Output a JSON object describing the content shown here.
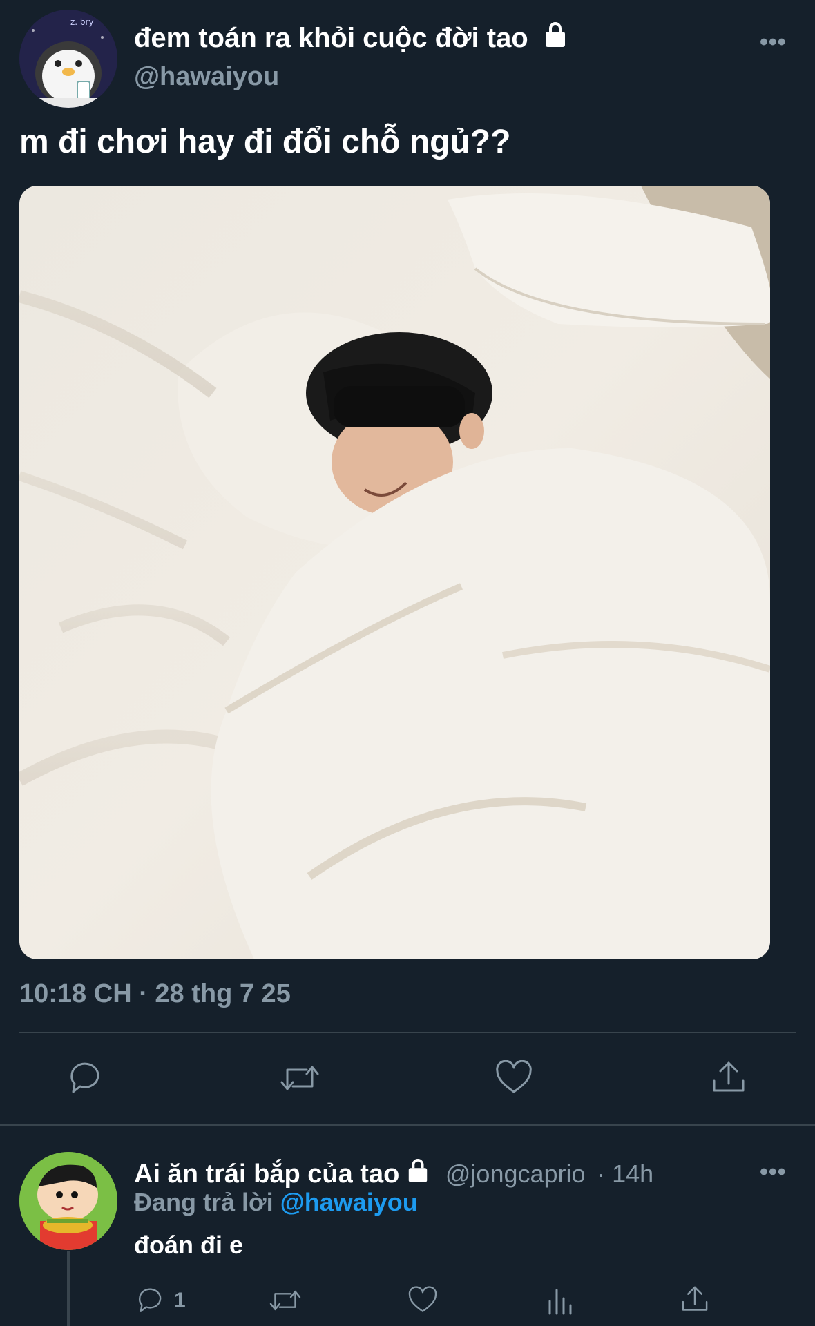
{
  "tweet": {
    "author_name": "đem toán ra khỏi cuộc đời tao",
    "author_handle": "@hawaiyou",
    "more_label": "•••",
    "text": "m đi chơi hay đi đổi chỗ ngủ??",
    "timestamp": "10:18 CH · 28 thg 7 25",
    "avatar_text": "z. bry"
  },
  "reply": {
    "author_name": "Ai ăn trái bắp của tao",
    "author_handle": "@jongcaprio",
    "time": "· 14h",
    "replying_prefix": "Đang trả lời",
    "replying_mention": "@hawaiyou",
    "text": "đoán đi e",
    "reply_count": "1",
    "more_label": "•••"
  },
  "colors": {
    "background": "#15202b",
    "secondary_text": "#8899a6",
    "divider": "#38444d",
    "accent": "#1d9bf0"
  },
  "icons": [
    "lock-icon",
    "reply-icon",
    "retweet-icon",
    "like-icon",
    "share-icon",
    "views-icon"
  ]
}
